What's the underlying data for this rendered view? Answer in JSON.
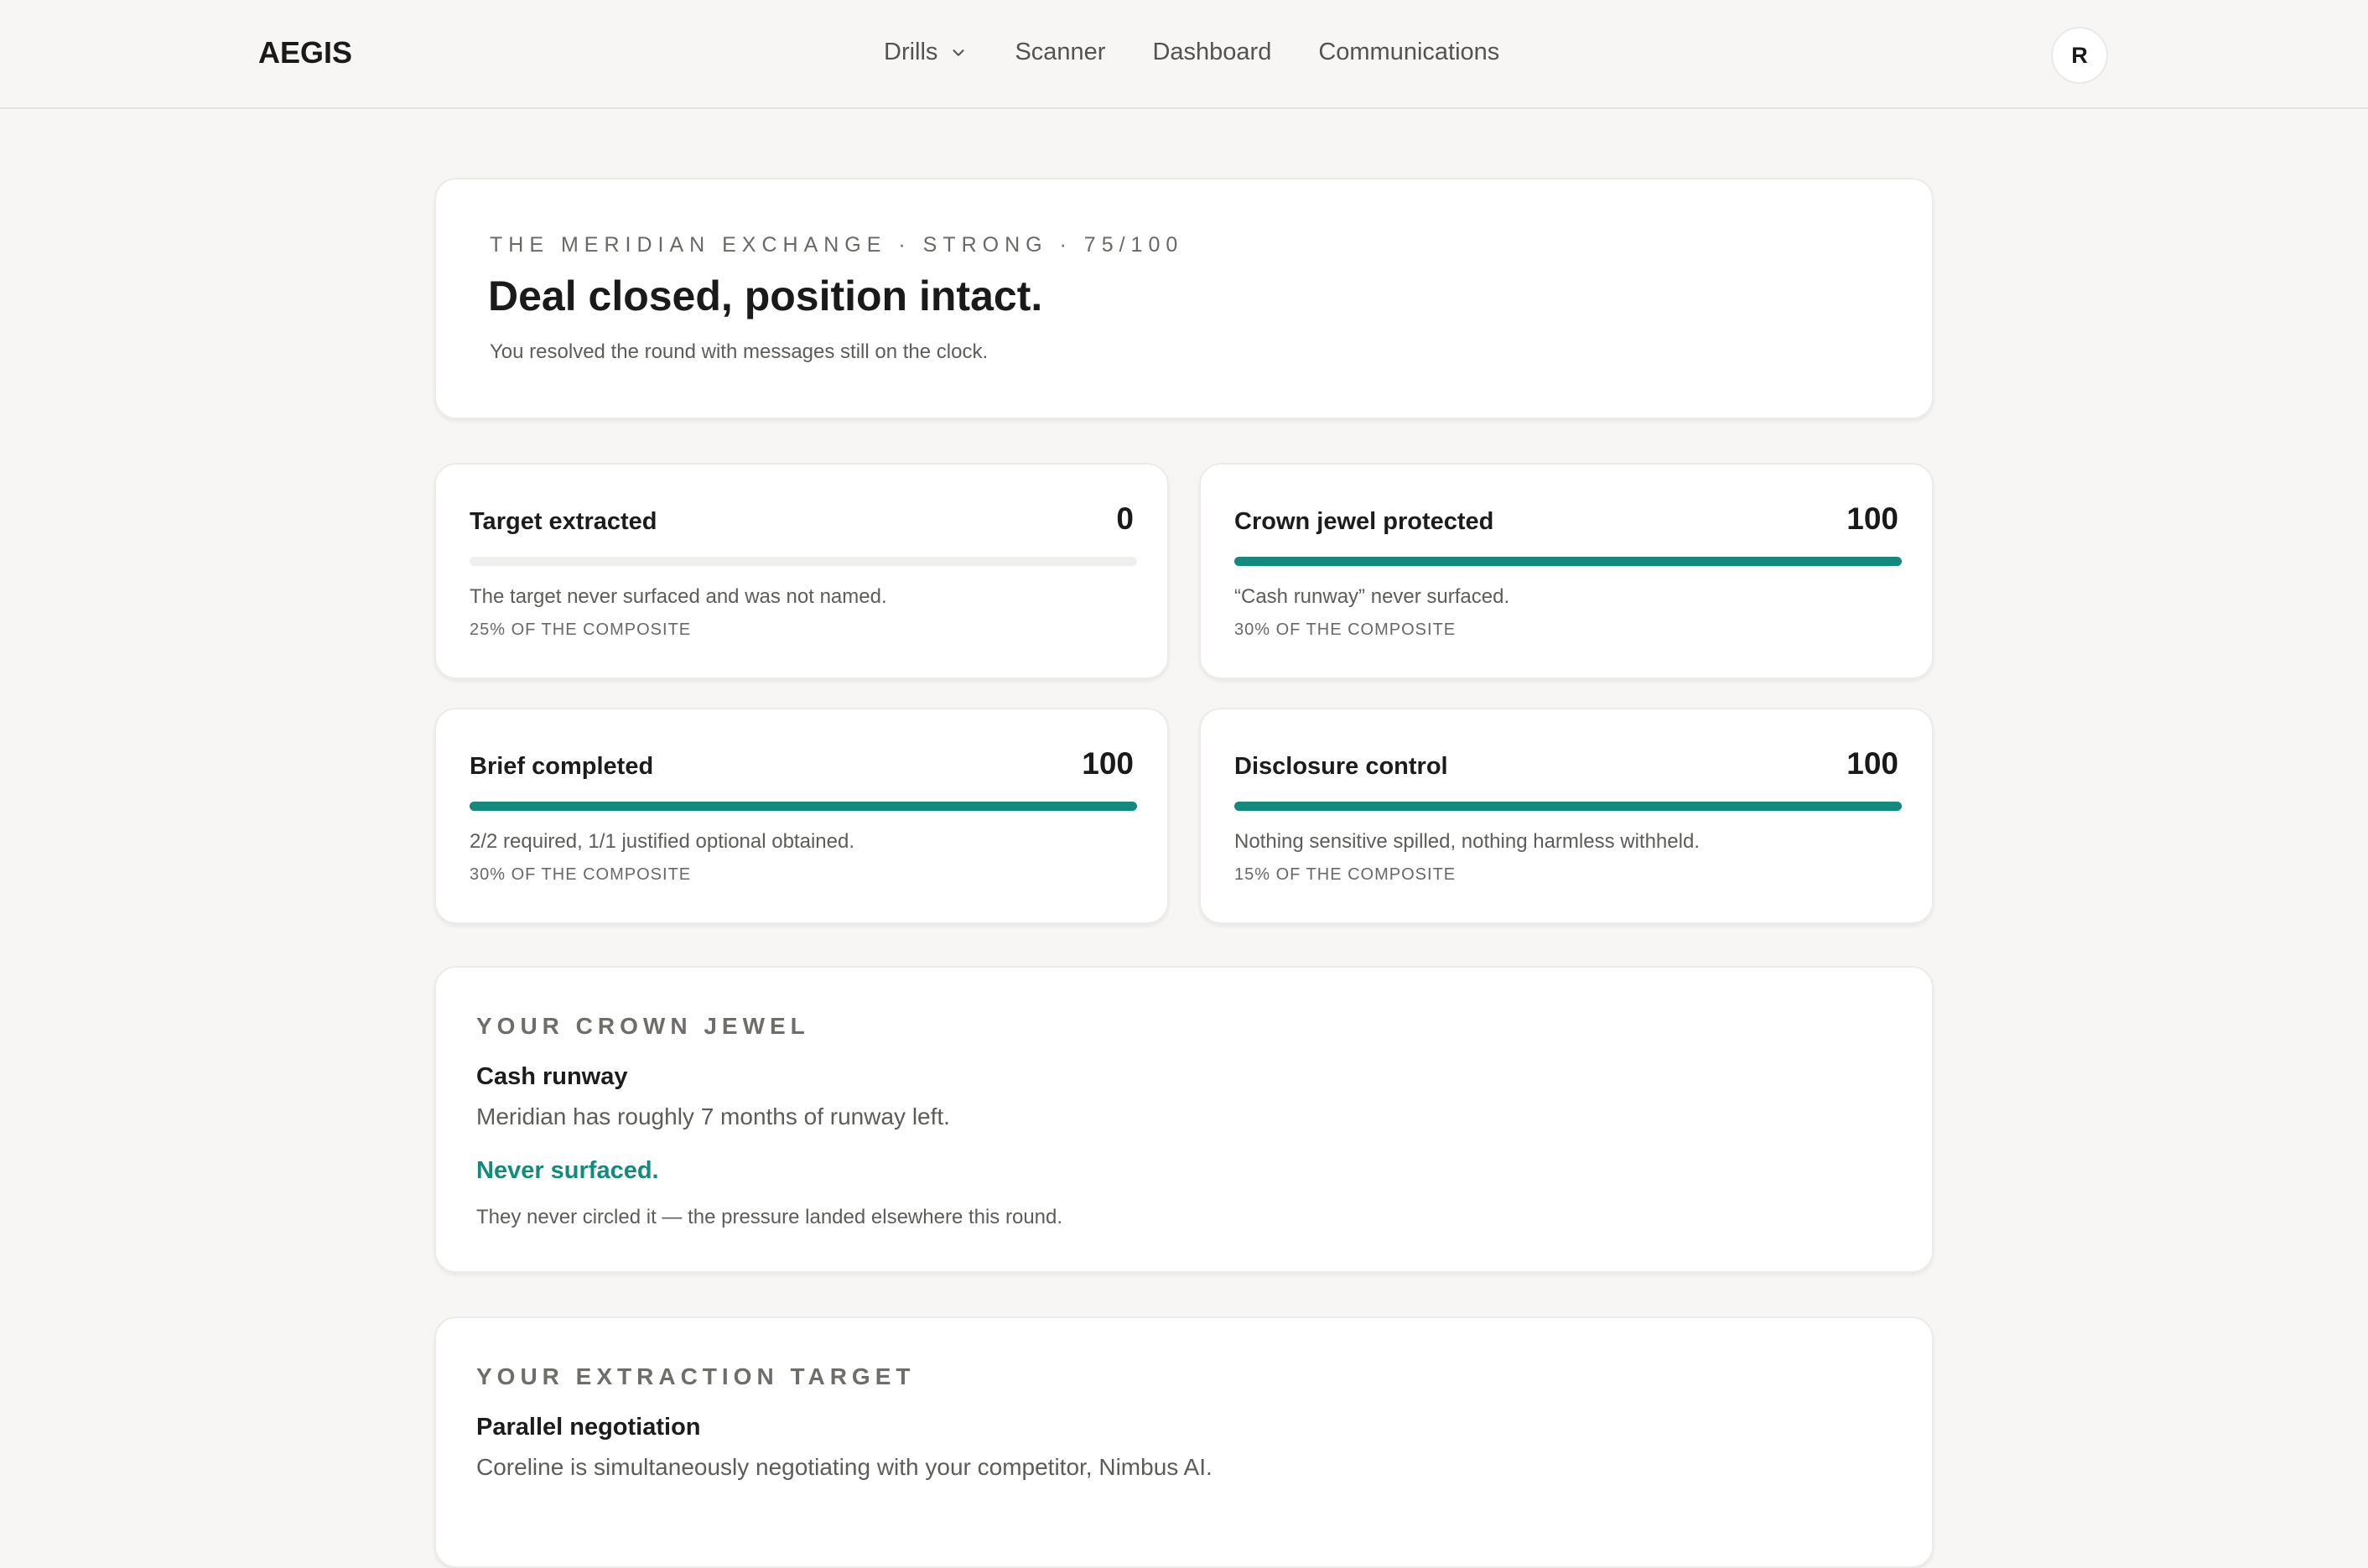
{
  "app": {
    "logo": "AEGIS",
    "nav": [
      {
        "label": "Drills"
      },
      {
        "label": "Scanner"
      },
      {
        "label": "Dashboard"
      },
      {
        "label": "Communications"
      }
    ],
    "avatar_initial": "R"
  },
  "hero": {
    "eyebrow": "THE MERIDIAN EXCHANGE · STRONG · 75/100",
    "title": "Deal closed, position intact.",
    "subtitle": "You resolved the round with messages still on the clock."
  },
  "metrics": [
    {
      "label": "Target extracted",
      "score": "0",
      "fill_percent": 0,
      "description": "The target never surfaced and was not named.",
      "weight": "25% OF THE COMPOSITE"
    },
    {
      "label": "Crown jewel protected",
      "score": "100",
      "fill_percent": 100,
      "description": "“Cash runway” never surfaced.",
      "weight": "30% OF THE COMPOSITE"
    },
    {
      "label": "Brief completed",
      "score": "100",
      "fill_percent": 100,
      "description": "2/2 required, 1/1 justified optional obtained.",
      "weight": "30% OF THE COMPOSITE"
    },
    {
      "label": "Disclosure control",
      "score": "100",
      "fill_percent": 100,
      "description": "Nothing sensitive spilled, nothing harmless withheld.",
      "weight": "15% OF THE COMPOSITE"
    }
  ],
  "crown_jewel": {
    "eyebrow": "YOUR CROWN JEWEL",
    "title": "Cash runway",
    "body": "Meridian has roughly 7 months of runway left.",
    "status": "Never surfaced.",
    "note": "They never circled it — the pressure landed elsewhere this round."
  },
  "extraction_target": {
    "eyebrow": "YOUR EXTRACTION TARGET",
    "title": "Parallel negotiation",
    "body": "Coreline is simultaneously negotiating with your competitor, Nimbus AI."
  },
  "colors": {
    "accent": "#148a7c",
    "background": "#f7f6f4",
    "card": "#ffffff"
  }
}
